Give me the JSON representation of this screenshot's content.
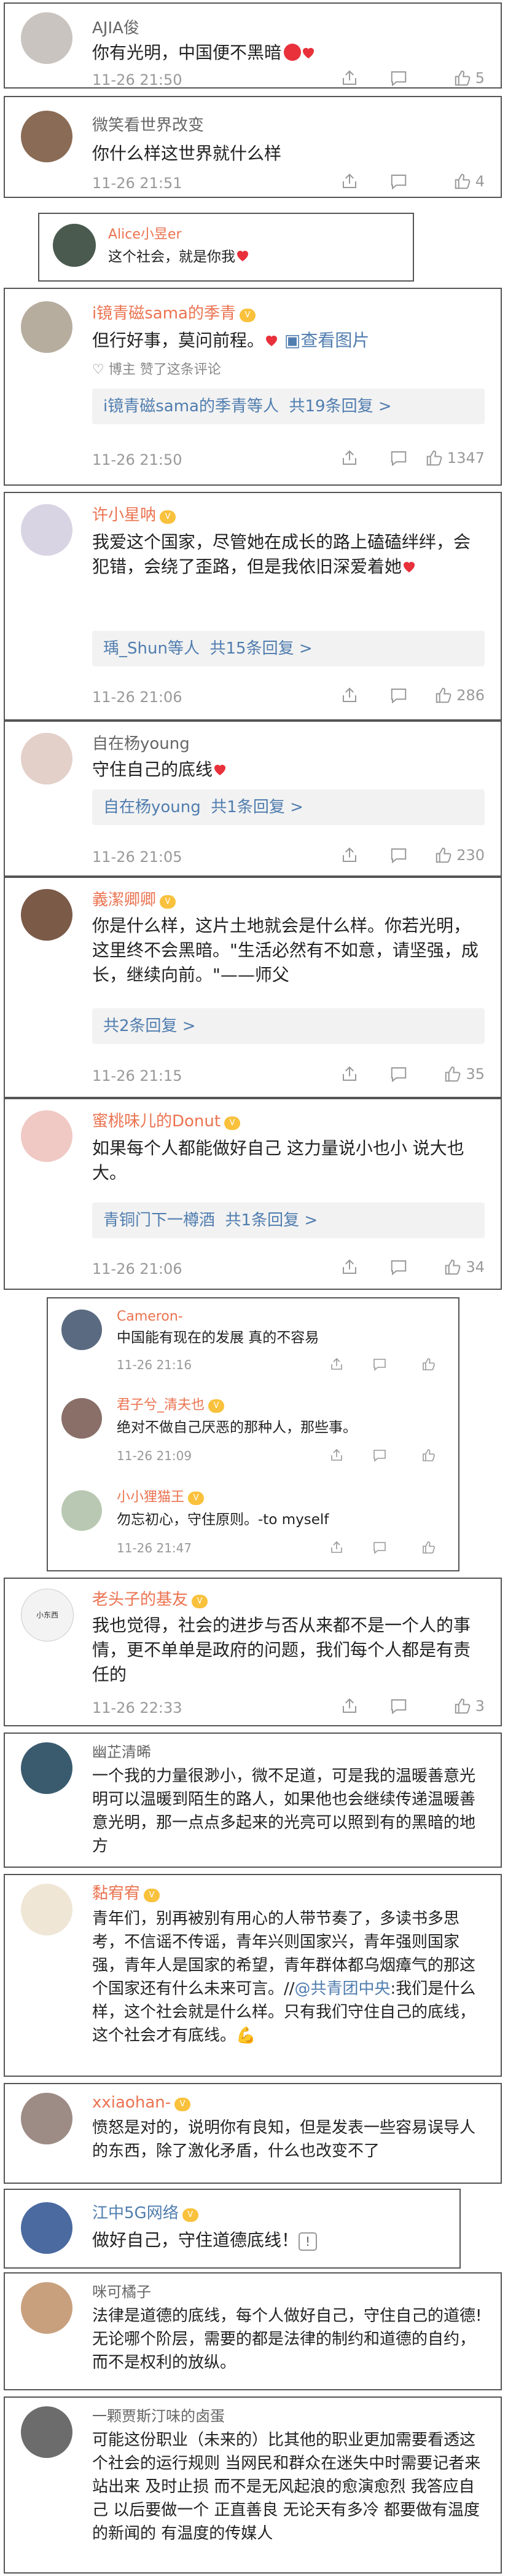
{
  "c1": {
    "name": "AJIA俊",
    "text": "你有光明，中国便不黑暗",
    "time": "11-26 21:50",
    "likes": "5"
  },
  "c2": {
    "name": "微笑看世界改变",
    "text": "你什么样这世界就什么样",
    "time": "11-26 21:51",
    "likes": "4"
  },
  "c3": {
    "name": "Alice小昱er",
    "text": "这个社会，就是你我"
  },
  "c4": {
    "name": "i镜青磁sama的季青",
    "text": "但行好事，莫问前程。",
    "pic": "查看图片",
    "liked_by": "博主 赞了这条评论",
    "reply_name": "i镜青磁sama的季青等人",
    "reply_count": "共19条回复 >",
    "time": "11-26 21:50",
    "likes": "1347"
  },
  "c5": {
    "name": "许小星呐",
    "text": "我爱这个国家，尽管她在成长的路上磕磕绊绊，会犯错，会绕了歪路，但是我依旧深爱着她",
    "reply_name": "瑀_Shun等人",
    "reply_count": "共15条回复 >",
    "time": "11-26 21:06",
    "likes": "286"
  },
  "c6": {
    "name": "自在杨young",
    "text": "守住自己的底线",
    "reply_name": "自在杨young",
    "reply_count": "共1条回复 >",
    "time": "11-26 21:05",
    "likes": "230"
  },
  "c7": {
    "name": "義潔卿卿",
    "text": "你是什么样，这片土地就会是什么样。你若光明，这里终不会黑暗。\"生活必然有不如意，请坚强，成长，继续向前。\"——师父",
    "reply_count": "共2条回复 >",
    "time": "11-26 21:15",
    "likes": "35"
  },
  "c8": {
    "name": "蜜桃味儿的Donut",
    "text": "如果每个人都能做好自己 这力量说小也小 说大也大。",
    "reply_name": "青铜门下一樽酒",
    "reply_count": "共1条回复 >",
    "time": "11-26 21:06",
    "likes": "34"
  },
  "c9": [
    {
      "name": "Cameron-",
      "text": "中国能有现在的发展 真的不容易",
      "time": "11-26 21:16"
    },
    {
      "name": "君子兮_清夫也",
      "text": "绝对不做自己厌恶的那种人，那些事。",
      "time": "11-26 21:09"
    },
    {
      "name": "小小狸猫王",
      "text": "勿忘初心，守住原则。-to myself",
      "time": "11-26 21:47"
    }
  ],
  "c10": {
    "name": "老头子的基友",
    "text": "我也觉得，社会的进步与否从来都不是一个人的事情，更不单单是政府的问题，我们每个人都是有责任的",
    "time": "11-26 22:33",
    "likes": "3",
    "avatar_text": "小东西"
  },
  "c11": {
    "name": "幽芷清晞",
    "text": "一个我的力量很渺小，微不足道，可是我的温暖善意光明可以温暖到陌生的路人，如果他也会继续传递温暖善意光明，那一点点多起来的光亮可以照到有的黑暗的地方"
  },
  "c12": {
    "name": "黏宥宥",
    "text_a": "青年们，别再被别有用心的人带节奏了，多读书多思考，不信谣不传谣，青年兴则国家兴，青年强则国家强，青年人是国家的希望，青年群体都乌烟瘴气的那这个国家还有什么未来可言。//",
    "mention": "@共青团中央",
    "text_b": ":我们是什么样，这个社会就是什么样。只有我们守住自己的底线，这个社会才有底线。"
  },
  "c13": {
    "name": "xxiaohan-",
    "text": "愤怒是对的，说明你有良知，但是发表一些容易误导人的东西，除了激化矛盾，什么也改变不了"
  },
  "c14": {
    "name": "江中5G网络",
    "text": "做好自己，守住道德底线！"
  },
  "c15": {
    "name": "咪可橘子",
    "text": "法律是道德的底线，每个人做好自己，守住自己的道德!无论哪个阶层，需要的都是法律的制约和道德的自约，而不是权利的放纵。"
  },
  "c16": {
    "name": "一颗贾斯汀味的卤蛋",
    "text": "可能这份职业（未来的）比其他的职业更加需要看透这个社会的运行规则 当网民和群众在迷失中时需要记者来站出来 及时止损 而不是无风起浪的愈演愈烈 我答应自己 以后要做一个 正直善良 无论天有多冷 都要做有温度的新闻的 有温度的传媒人"
  },
  "colors": {
    "orange": "#eb7350",
    "blue": "#507daf",
    "border": "#555555"
  }
}
